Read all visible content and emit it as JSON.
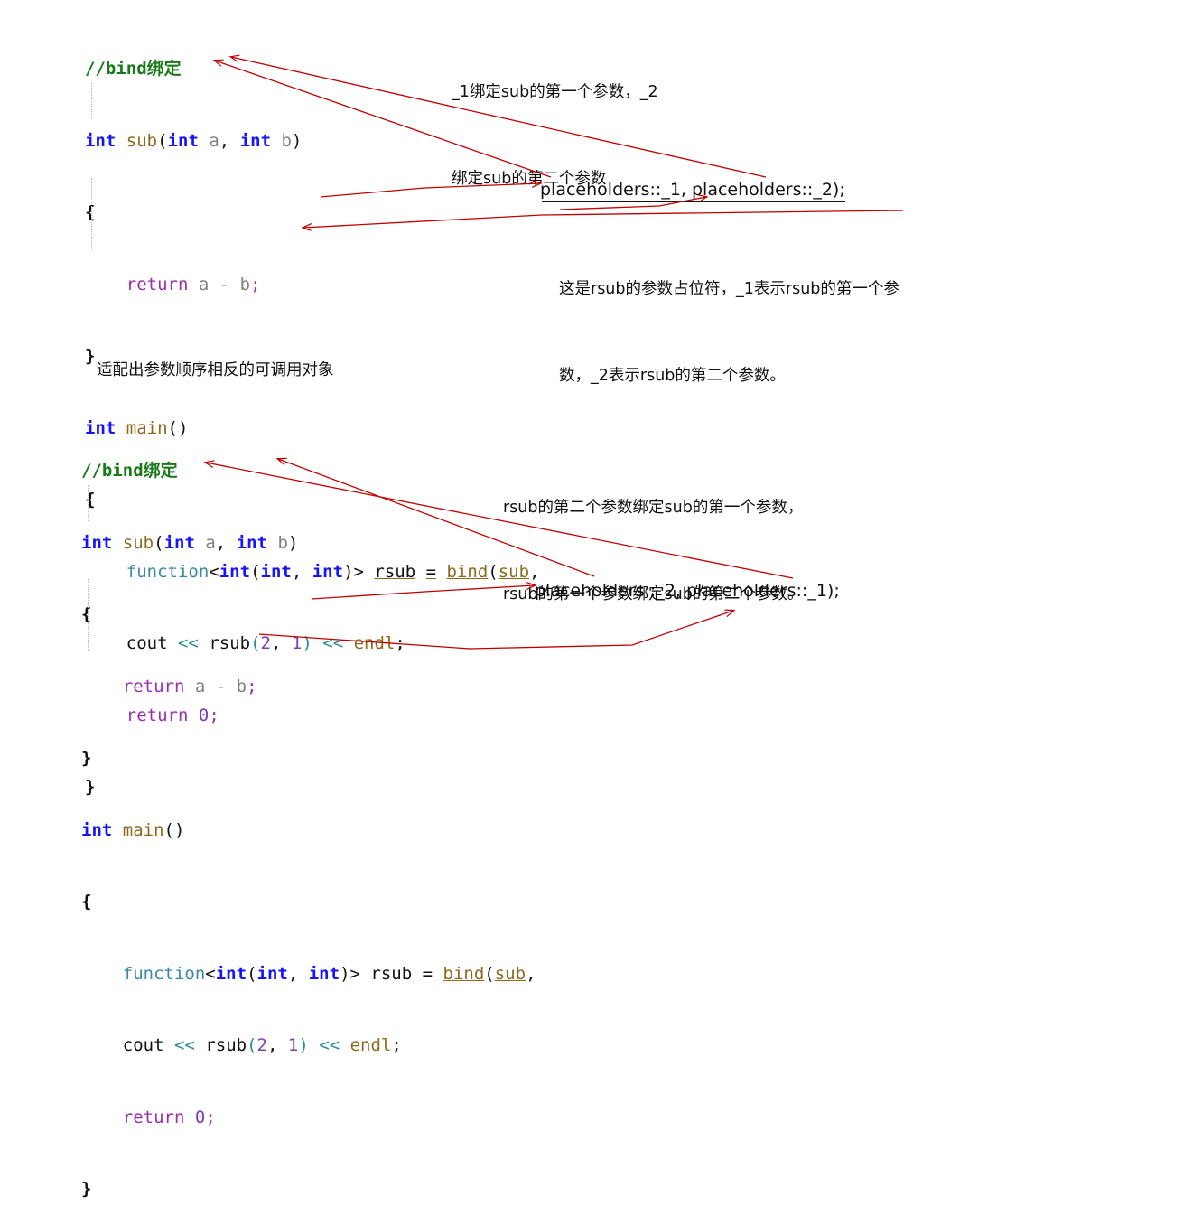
{
  "page": {
    "title": "C++ bind 绑定示例标注图",
    "background": "#ffffff",
    "annotation_color": "#c00000"
  },
  "colors": {
    "comment": "#1a7a1a",
    "keyword": "#1414ff",
    "function_name": "#8a6a1e",
    "variable": "#808080",
    "return_keyword": "#9b2fae",
    "type_template": "#3b8a9e",
    "operator": "#2a8f92",
    "number": "#7a3fb5",
    "plain": "#111111",
    "arrow": "#c00000"
  },
  "block1": {
    "name": "first-code-block",
    "lines": [
      {
        "id": "l1",
        "text": "//bind绑定"
      },
      {
        "id": "l2",
        "text": "int sub(int a, int b)"
      },
      {
        "id": "l3",
        "text": "{"
      },
      {
        "id": "l4",
        "text": "    return a - b;"
      },
      {
        "id": "l5",
        "text": "}"
      },
      {
        "id": "l6",
        "text": "int main()"
      },
      {
        "id": "l7",
        "text": "{"
      },
      {
        "id": "l8",
        "text": "    function<int(int, int)> rsub = bind(sub,"
      },
      {
        "id": "l9",
        "text": "    cout << rsub(2, 1) << endl;"
      },
      {
        "id": "l10",
        "text": "    return 0;"
      },
      {
        "id": "l11",
        "text": "}"
      }
    ],
    "tokens": {
      "comment": "//bind绑定",
      "kw_int": "int",
      "fn_sub": "sub",
      "fn_main": "main",
      "var_a": "a",
      "var_b": "b",
      "kw_return": "return",
      "type_function": "function",
      "id_rsub": "rsub",
      "fn_bind": "bind",
      "id_cout": "cout",
      "id_endl": "endl",
      "num_2": "2",
      "num_1": "1",
      "num_0": "0",
      "op_shift": "<<",
      "op_minus": "-",
      "op_eq": "="
    },
    "placeholders_text": "placeholders::_1, placeholders::_2);"
  },
  "block2": {
    "name": "second-code-block",
    "lines": [
      {
        "id": "l1",
        "text": "//bind绑定"
      },
      {
        "id": "l2",
        "text": "int sub(int a, int b)"
      },
      {
        "id": "l3",
        "text": "{"
      },
      {
        "id": "l4",
        "text": "    return a - b;"
      },
      {
        "id": "l5",
        "text": "}"
      },
      {
        "id": "l6",
        "text": "int main()"
      },
      {
        "id": "l7",
        "text": "{"
      },
      {
        "id": "l8",
        "text": "    function<int(int, int)> rsub = bind(sub,"
      },
      {
        "id": "l9",
        "text": "    cout << rsub(2, 1) << endl;"
      },
      {
        "id": "l10",
        "text": "    return 0;"
      },
      {
        "id": "l11",
        "text": "}"
      }
    ],
    "placeholders_text": "placeholders::_2, placeholders::_1);"
  },
  "notes": {
    "note1_line1": "_1绑定sub的第一个参数，_2",
    "note1_line2": "绑定sub的第二个参数",
    "note2_line1": "这是rsub的参数占位符，_1表示rsub的第一个参",
    "note2_line2": "数，_2表示rsub的第二个参数。",
    "middle": "适配出参数顺序相反的可调用对象",
    "note3_line1": "rsub的第二个参数绑定sub的第一个参数，",
    "note3_line2": "rsub的第一个参数绑定sub的第二个参数。"
  }
}
